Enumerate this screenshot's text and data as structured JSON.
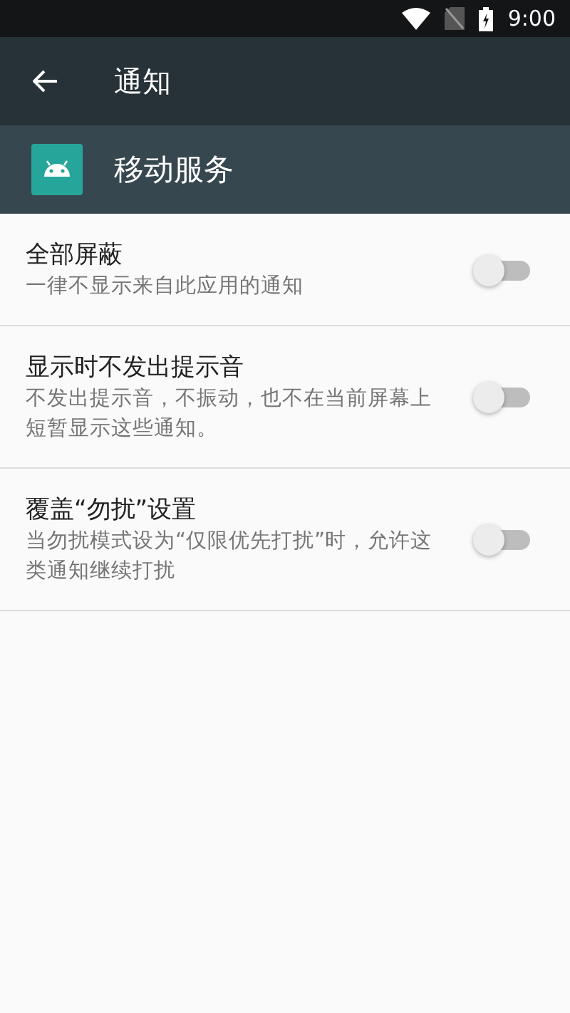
{
  "status_bar": {
    "time": "9:00"
  },
  "toolbar": {
    "title": "通知"
  },
  "app_header": {
    "name": "移动服务"
  },
  "settings": [
    {
      "title": "全部屏蔽",
      "summary": "一律不显示来自此应用的通知",
      "on": false
    },
    {
      "title": "显示时不发出提示音",
      "summary": "不发出提示音，不振动，也不在当前屏幕上短暂显示这些通知。",
      "on": false
    },
    {
      "title": "覆盖“勿扰”设置",
      "summary": "当勿扰模式设为“仅限优先打扰”时，允许这类通知继续打扰",
      "on": false
    }
  ]
}
